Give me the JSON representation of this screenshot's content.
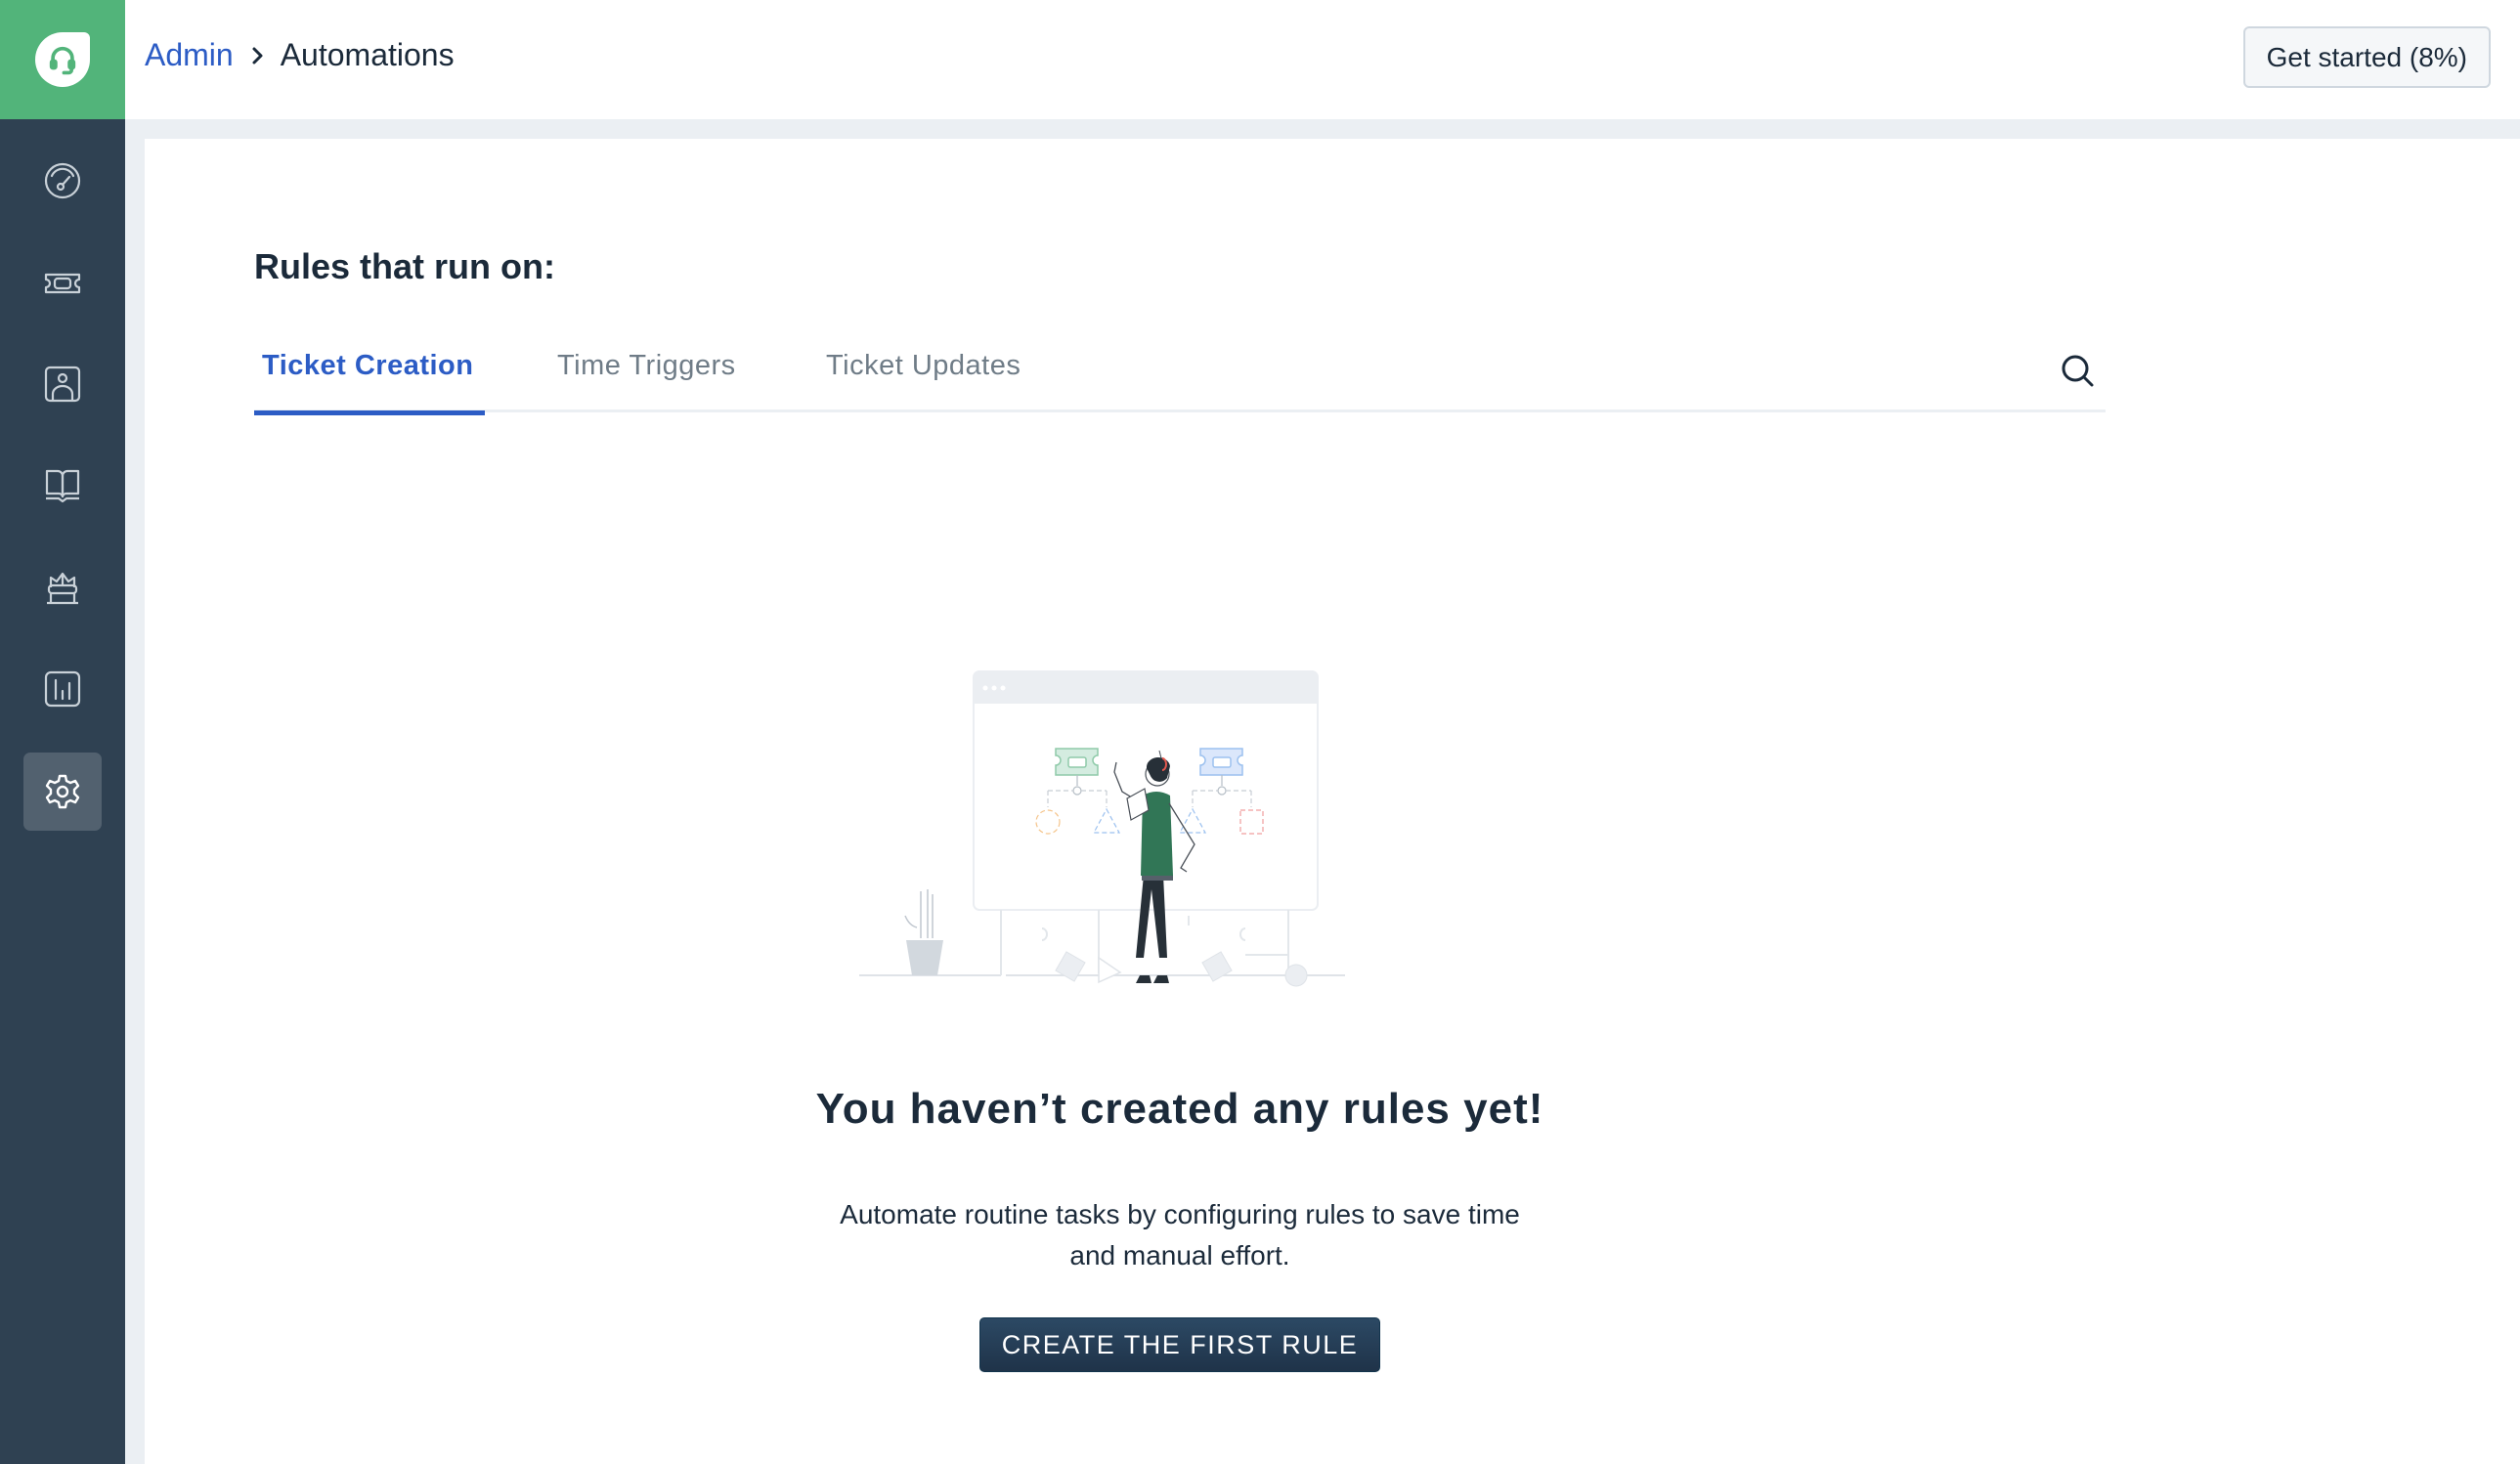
{
  "app": {
    "logo_icon": "headset-icon",
    "brand_color": "#52b47a",
    "sidebar_color": "#2f4152",
    "accent_color": "#2c5cc5"
  },
  "sidebar": {
    "items": [
      {
        "name": "dashboard",
        "icon": "speedometer-icon",
        "active": false
      },
      {
        "name": "tickets",
        "icon": "ticket-icon",
        "active": false
      },
      {
        "name": "contacts",
        "icon": "contact-card-icon",
        "active": false
      },
      {
        "name": "solutions",
        "icon": "open-book-icon",
        "active": false
      },
      {
        "name": "freddy-bot",
        "icon": "bot-icon",
        "active": false
      },
      {
        "name": "analytics",
        "icon": "bar-chart-icon",
        "active": false
      },
      {
        "name": "admin",
        "icon": "gear-icon",
        "active": true
      }
    ]
  },
  "header": {
    "breadcrumb": {
      "parent": "Admin",
      "separator_icon": "chevron-right-icon",
      "current": "Automations"
    },
    "get_started_label": "Get started (8%)"
  },
  "main": {
    "section_title": "Rules that run on:",
    "tabs": [
      {
        "label": "Ticket Creation",
        "active": true
      },
      {
        "label": "Time Triggers",
        "active": false
      },
      {
        "label": "Ticket Updates",
        "active": false
      }
    ],
    "search_icon": "search-icon",
    "empty_state": {
      "illustration": "person-building-workflow-illustration",
      "title": "You haven’t created any rules yet!",
      "description_line1": "Automate routine tasks by configuring rules to save time",
      "description_line2": "and manual effort.",
      "cta_label": "CREATE THE FIRST RULE"
    }
  }
}
